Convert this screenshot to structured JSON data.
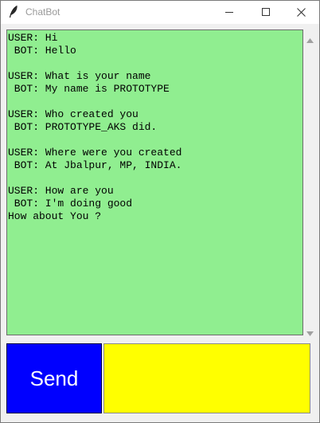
{
  "window": {
    "title": "ChatBot",
    "icon": "feather-icon",
    "controls": [
      "minimize-icon",
      "maximize-icon",
      "close-icon"
    ]
  },
  "chatlog": {
    "lines": [
      "USER: Hi",
      " BOT: Hello",
      "",
      "USER: What is your name",
      " BOT: My name is PROTOTYPE",
      "",
      "USER: Who created you",
      " BOT: PROTOTYPE_AKS did.",
      "",
      "USER: Where were you created",
      " BOT: At Jbalpur, MP, INDIA.",
      "",
      "USER: How are you",
      " BOT: I'm doing good",
      "How about You ?"
    ],
    "background": "#90ee90"
  },
  "send_button": {
    "label": "Send",
    "background": "#0000ff",
    "text_color": "#ffffff"
  },
  "entry": {
    "value": "",
    "background": "#ffff00"
  }
}
